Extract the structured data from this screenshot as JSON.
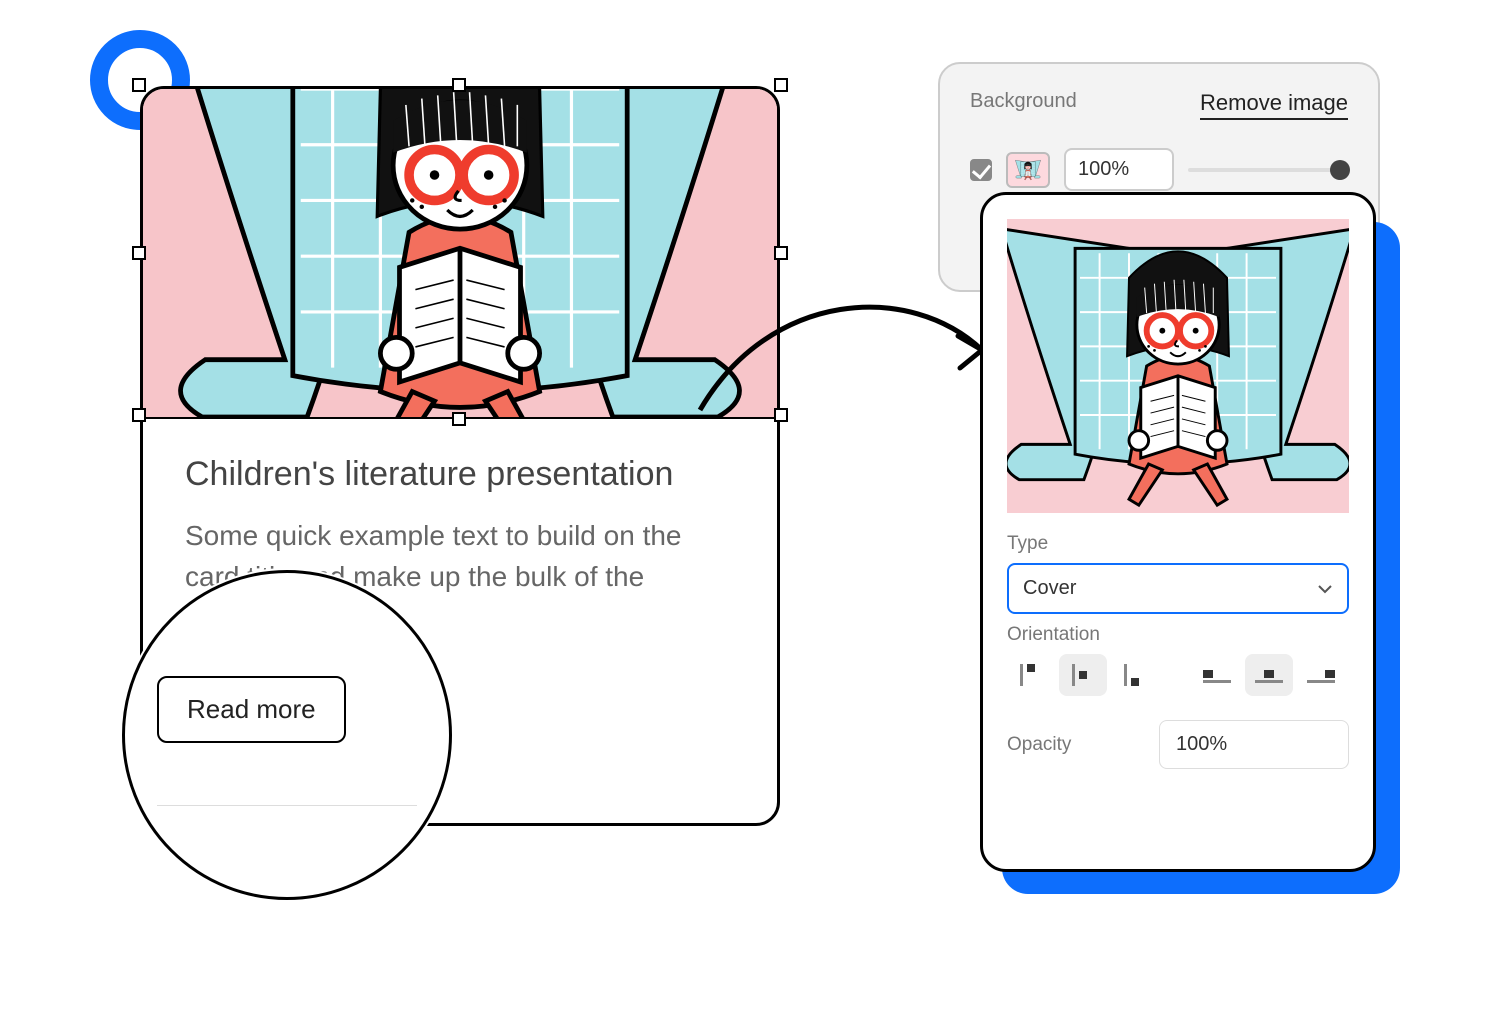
{
  "card": {
    "title": "Children's literature presentation",
    "text": "Some quick example text to build on the card title and make up the bulk of the",
    "button": "Read more"
  },
  "background_panel": {
    "title": "Background",
    "remove_label": "Remove image",
    "checkbox_on": true,
    "opacity_value": "100%"
  },
  "image_options": {
    "type_label": "Type",
    "type_value": "Cover",
    "orientation_label": "Orientation",
    "orientation": {
      "v_options": [
        "top",
        "center",
        "bottom"
      ],
      "v_selected": "center",
      "h_options": [
        "left",
        "center",
        "right"
      ],
      "h_selected": "center"
    },
    "opacity_label": "Opacity",
    "opacity_value": "100%"
  },
  "colors": {
    "accent": "#0d6efd"
  }
}
